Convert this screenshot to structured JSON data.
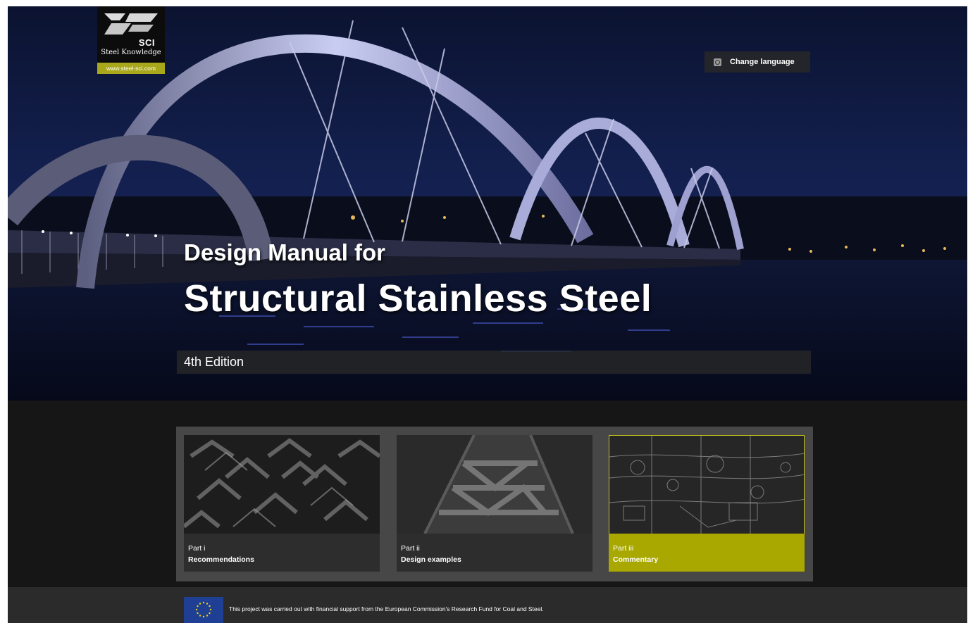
{
  "header": {
    "logo_sci": "SCI",
    "logo_tagline": "Steel Knowledge",
    "logo_url": "www.steel-sci.com",
    "change_language": "Change language"
  },
  "hero": {
    "title_line1": "Design Manual for",
    "title_line2": "Structural Stainless Steel",
    "edition": "4th Edition"
  },
  "cards": [
    {
      "part": "Part i",
      "name": "Recommendations",
      "active": false
    },
    {
      "part": "Part ii",
      "name": "Design examples",
      "active": false
    },
    {
      "part": "Part iii",
      "name": "Commentary",
      "active": true
    }
  ],
  "footer": {
    "text": "This project was carried out with financial support from the European Commission's Research Fund for Coal and Steel."
  },
  "colors": {
    "accent": "#a8a800",
    "background": "#161616",
    "card_bg": "#2d2d2d",
    "eu_blue": "#1f3f95"
  },
  "icons": [
    "sci-logo-icon",
    "globe-icon",
    "eu-flag-icon"
  ]
}
